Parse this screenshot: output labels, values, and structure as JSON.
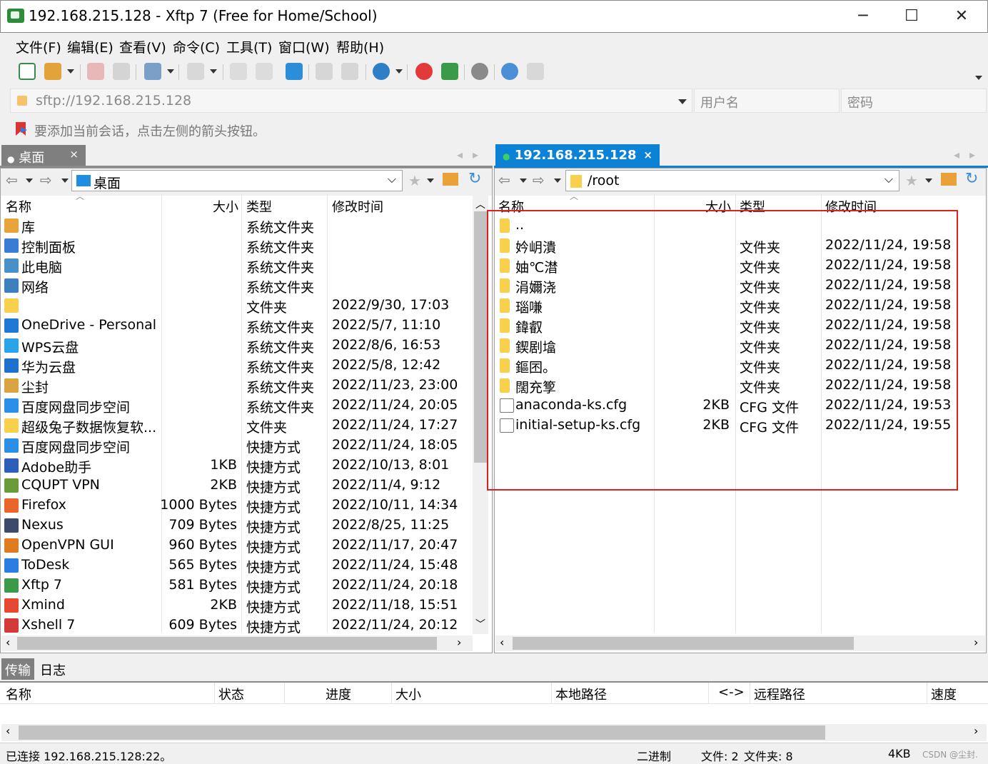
{
  "window": {
    "title": "192.168.215.128 - Xftp 7 (Free for Home/School)",
    "minimize": "─",
    "maximize": "☐",
    "close": "✕"
  },
  "menu": [
    "文件(F)",
    "编辑(E)",
    "查看(V)",
    "命令(C)",
    "工具(T)",
    "窗口(W)",
    "帮助(H)"
  ],
  "address": {
    "url": "sftp://192.168.215.128",
    "username_placeholder": "用户名",
    "password_placeholder": "密码"
  },
  "hint": "要添加当前会话，点击左侧的箭头按钮。",
  "local_pane": {
    "tab_label": "桌面",
    "tab_close": "×",
    "path": "桌面",
    "columns": [
      "名称",
      "大小",
      "类型",
      "修改时间"
    ],
    "rows": [
      {
        "name": "库",
        "size": "",
        "type": "系统文件夹",
        "mtime": "",
        "icon": "library-icon",
        "color": "#e8a33a"
      },
      {
        "name": "控制面板",
        "size": "",
        "type": "系统文件夹",
        "mtime": "",
        "icon": "control-panel-icon",
        "color": "#3a7bd5"
      },
      {
        "name": "此电脑",
        "size": "",
        "type": "系统文件夹",
        "mtime": "",
        "icon": "computer-icon",
        "color": "#4a90c8"
      },
      {
        "name": "网络",
        "size": "",
        "type": "系统文件夹",
        "mtime": "",
        "icon": "network-icon",
        "color": "#3d7fbf"
      },
      {
        "name": "",
        "size": "",
        "type": "文件夹",
        "mtime": "2022/9/30, 17:03",
        "icon": "folder-icon",
        "color": "#f9d04c"
      },
      {
        "name": "OneDrive - Personal",
        "size": "",
        "type": "系统文件夹",
        "mtime": "2022/5/7, 11:10",
        "icon": "onedrive-icon",
        "color": "#1e78d4"
      },
      {
        "name": "WPS云盘",
        "size": "",
        "type": "系统文件夹",
        "mtime": "2022/8/6, 16:53",
        "icon": "wps-cloud-icon",
        "color": "#2aa4e8"
      },
      {
        "name": "华为云盘",
        "size": "",
        "type": "系统文件夹",
        "mtime": "2022/5/8, 12:42",
        "icon": "huawei-cloud-icon",
        "color": "#1f6fd1"
      },
      {
        "name": "尘封",
        "size": "",
        "type": "系统文件夹",
        "mtime": "2022/11/23, 23:00",
        "icon": "user-folder-icon",
        "color": "#d9a441"
      },
      {
        "name": "百度网盘同步空间",
        "size": "",
        "type": "系统文件夹",
        "mtime": "2022/11/24, 20:05",
        "icon": "baidu-sync-icon",
        "color": "#2b8ee8"
      },
      {
        "name": "超级兔子数据恢复软...",
        "size": "",
        "type": "文件夹",
        "mtime": "2022/11/24, 17:27",
        "icon": "folder-icon",
        "color": "#f9d04c"
      },
      {
        "name": "百度网盘同步空间",
        "size": "",
        "type": "快捷方式",
        "mtime": "2022/11/24, 18:05",
        "icon": "baidu-shortcut-icon",
        "color": "#2b8ee8"
      },
      {
        "name": "Adobe助手",
        "size": "1KB",
        "type": "快捷方式",
        "mtime": "2022/10/13, 8:01",
        "icon": "adobe-icon",
        "color": "#2d5fb8"
      },
      {
        "name": "CQUPT VPN",
        "size": "2KB",
        "type": "快捷方式",
        "mtime": "2022/11/4, 9:12",
        "icon": "vpn-icon",
        "color": "#6a9a3a"
      },
      {
        "name": "Firefox",
        "size": "1000 Bytes",
        "type": "快捷方式",
        "mtime": "2022/10/11, 14:34",
        "icon": "firefox-icon",
        "color": "#e8662a"
      },
      {
        "name": "Nexus",
        "size": "709 Bytes",
        "type": "快捷方式",
        "mtime": "2022/8/25, 11:25",
        "icon": "nexus-icon",
        "color": "#3c4a6e"
      },
      {
        "name": "OpenVPN GUI",
        "size": "960 Bytes",
        "type": "快捷方式",
        "mtime": "2022/11/17, 20:47",
        "icon": "openvpn-icon",
        "color": "#e07b22"
      },
      {
        "name": "ToDesk",
        "size": "565 Bytes",
        "type": "快捷方式",
        "mtime": "2022/11/24, 15:48",
        "icon": "todesk-icon",
        "color": "#2a7de1"
      },
      {
        "name": "Xftp 7",
        "size": "581 Bytes",
        "type": "快捷方式",
        "mtime": "2022/11/24, 20:18",
        "icon": "xftp-icon",
        "color": "#3a9a4a"
      },
      {
        "name": "Xmind",
        "size": "2KB",
        "type": "快捷方式",
        "mtime": "2022/11/18, 15:51",
        "icon": "xmind-icon",
        "color": "#e34a2f"
      },
      {
        "name": "Xshell 7",
        "size": "609 Bytes",
        "type": "快捷方式",
        "mtime": "2022/11/24, 20:12",
        "icon": "xshell-icon",
        "color": "#d43a3a"
      }
    ]
  },
  "remote_pane": {
    "tab_label": "192.168.215.128",
    "tab_close": "×",
    "path": "/root",
    "columns": [
      "名称",
      "大小",
      "类型",
      "修改时间"
    ],
    "rows": [
      {
        "name": "..",
        "size": "",
        "type": "",
        "mtime": "",
        "kind": "folder"
      },
      {
        "name": "妗岄潰",
        "size": "",
        "type": "文件夹",
        "mtime": "2022/11/24, 19:58",
        "kind": "folder"
      },
      {
        "name": "妯℃澘",
        "size": "",
        "type": "文件夹",
        "mtime": "2022/11/24, 19:58",
        "kind": "folder"
      },
      {
        "name": "涓嬭浇",
        "size": "",
        "type": "文件夹",
        "mtime": "2022/11/24, 19:58",
        "kind": "folder"
      },
      {
        "name": "瑙嗛",
        "size": "",
        "type": "文件夹",
        "mtime": "2022/11/24, 19:58",
        "kind": "folder"
      },
      {
        "name": "鍏叡",
        "size": "",
        "type": "文件夹",
        "mtime": "2022/11/24, 19:58",
        "kind": "folder"
      },
      {
        "name": "鍥剧墖",
        "size": "",
        "type": "文件夹",
        "mtime": "2022/11/24, 19:58",
        "kind": "folder"
      },
      {
        "name": "鏂囨。",
        "size": "",
        "type": "文件夹",
        "mtime": "2022/11/24, 19:58",
        "kind": "folder"
      },
      {
        "name": "闊充箰",
        "size": "",
        "type": "文件夹",
        "mtime": "2022/11/24, 19:58",
        "kind": "folder"
      },
      {
        "name": "anaconda-ks.cfg",
        "size": "2KB",
        "type": "CFG 文件",
        "mtime": "2022/11/24, 19:53",
        "kind": "file"
      },
      {
        "name": "initial-setup-ks.cfg",
        "size": "2KB",
        "type": "CFG 文件",
        "mtime": "2022/11/24, 19:55",
        "kind": "file"
      }
    ]
  },
  "transfer": {
    "tabs": [
      "传输",
      "日志"
    ],
    "columns": [
      "名称",
      "状态",
      "进度",
      "大小",
      "本地路径",
      "<->",
      "远程路径",
      "速度"
    ]
  },
  "status": {
    "connection": "已连接 192.168.215.128:22。",
    "mode": "二进制",
    "files": "文件: 2",
    "folders": "文件夹: 8",
    "size": "4KB",
    "watermark": "CSDN @尘封."
  }
}
